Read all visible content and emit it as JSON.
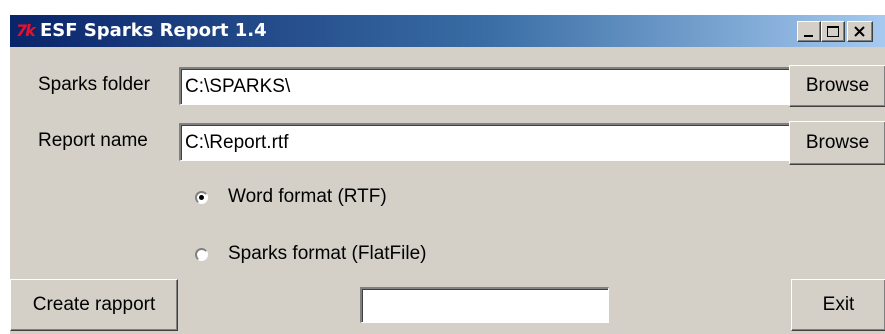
{
  "window": {
    "title": "ESF Sparks Report 1.4",
    "icon": "tk-app-icon",
    "icon_text": "7k"
  },
  "title_controls": {
    "minimize": "minimize-icon",
    "maximize": "maximize-icon",
    "close": "close-icon"
  },
  "form": {
    "sparks_folder_label": "Sparks folder",
    "sparks_folder_value": "C:\\SPARKS\\",
    "report_name_label": "Report name",
    "report_name_value": "C:\\Report.rtf",
    "browse_label": "Browse"
  },
  "format_options": [
    {
      "label": "Word format (RTF)",
      "selected": true
    },
    {
      "label": "Sparks format (FlatFile)",
      "selected": false
    }
  ],
  "bottom": {
    "create_label": "Create rapport",
    "status_value": "",
    "exit_label": "Exit"
  },
  "colors": {
    "window_bg": "#d4d0c8",
    "title_start": "#0a246a",
    "title_end": "#a6caf0",
    "icon_red": "#e8102a"
  }
}
